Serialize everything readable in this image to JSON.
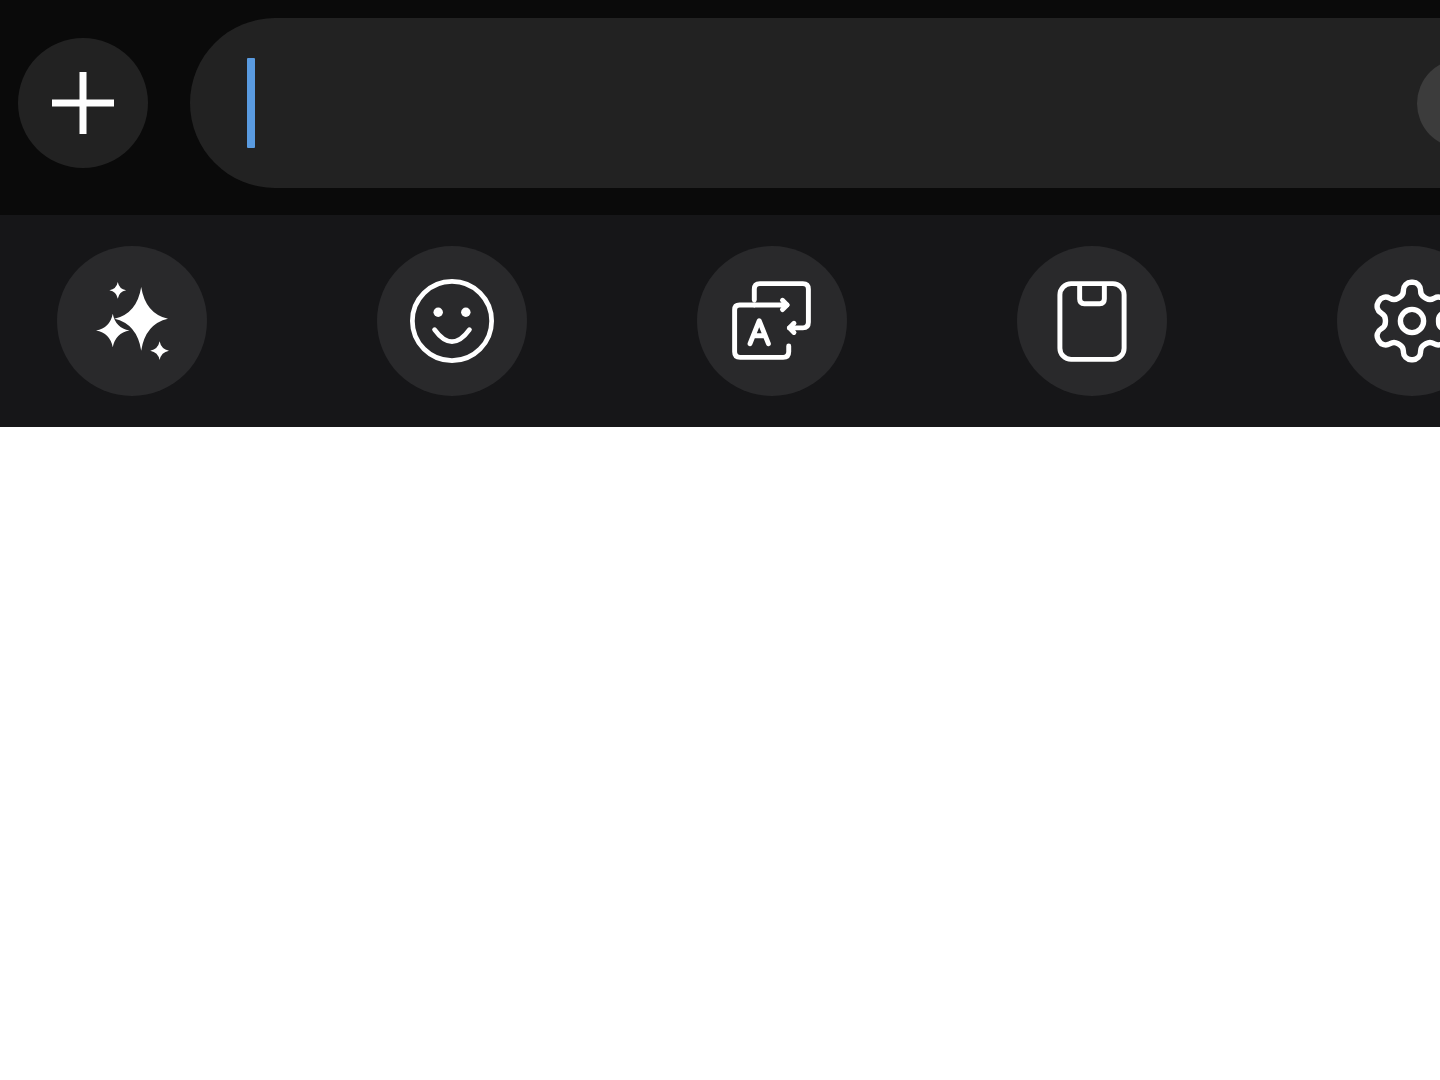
{
  "composer": {
    "leading_button": {
      "kind": "add"
    },
    "input": {
      "focused": true
    },
    "trailing_button": {
      "kind": "blank"
    }
  },
  "toolbar": {
    "items": [
      {
        "kind": "sparkle"
      },
      {
        "kind": "emoji"
      },
      {
        "kind": "translate"
      },
      {
        "kind": "clipboard"
      },
      {
        "kind": "settings"
      }
    ]
  }
}
